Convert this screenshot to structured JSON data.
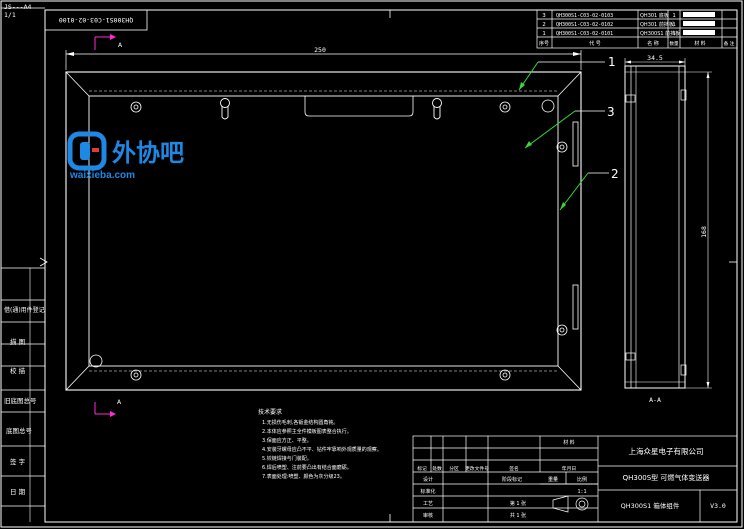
{
  "sheet": {
    "format": "JS---A4",
    "sheet_no": "1/1"
  },
  "drawing_number_rotated": "QH300S1-C03-02-0100",
  "watermark": {
    "name": "外协吧",
    "url": "waixieba.com",
    "accent": "#1e88e5"
  },
  "dimensions": {
    "width": "250",
    "depth": "34.5",
    "height": "168"
  },
  "section_marker": "A",
  "section_view_label": "A-A",
  "callouts": [
    "1",
    "3",
    "2"
  ],
  "parts_list": {
    "rows": [
      {
        "no": "3",
        "code": "QH300S1-C03-02-0103",
        "name": "QH301 底板",
        "qty": "1"
      },
      {
        "no": "2",
        "code": "QH300S1-C03-02-0102",
        "name": "QH301 前挡板",
        "qty": "1"
      },
      {
        "no": "1",
        "code": "QH300S1-C03-02-0101",
        "name": "QH300S1 前挡板",
        "qty": "1"
      }
    ],
    "header": [
      "序号",
      "代 号",
      "名 称",
      "数量",
      "材 料",
      "单件",
      "总计",
      "备 注"
    ]
  },
  "left_strip": [
    "借(通)用件登记",
    "描 图",
    "校 描",
    "旧底图总号",
    "底图总号",
    "签 字",
    "日 期"
  ],
  "notes": {
    "title": "技术要求",
    "lines": [
      "1.无损伤毛刺,各钣金结构圆角钝。",
      "2.本体应参照主全件模板图表整合执行。",
      "3.保面应方正、平整。",
      "4.安装牙螺母应凸不平、钻件牢靠响外观质量的观察。",
      "5.铰链焊接与门装配。",
      "6.焊后喷塑、注前要凸出有结合面磨砺。",
      "7.表面处理:喷塑、颜色为灰分级23。"
    ]
  },
  "title_block": {
    "company": "上海众星电子有限公司",
    "product": "QH300S型 可燃气体变送器",
    "part_name": "QH300S1 箱体组件",
    "version": "V3.0",
    "row_labels": [
      "标记",
      "处数",
      "分区",
      "更改文件号",
      "签名",
      "年月日"
    ],
    "staff_labels": [
      "设计",
      "标准化",
      "工艺",
      "审核",
      "批准"
    ],
    "material_label": "材 料",
    "stage_labels": [
      "阶段标记",
      "重量",
      "比例"
    ],
    "scale": "1:1",
    "sheets_total": "共 1 张",
    "sheet_current": "第 1 张"
  }
}
